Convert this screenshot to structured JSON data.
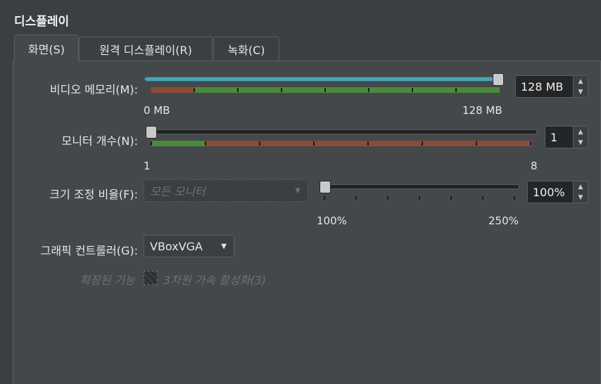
{
  "section_title": "디스플레이",
  "tabs": [
    {
      "label": "화면(S)",
      "active": true
    },
    {
      "label": "원격 디스플레이(R)",
      "active": false
    },
    {
      "label": "녹화(C)",
      "active": false
    }
  ],
  "video_memory": {
    "label": "비디오 메모리(M):",
    "value": "128 MB",
    "min_label": "0 MB",
    "max_label": "128 MB",
    "level_fraction": 1.0
  },
  "monitor_count": {
    "label": "모니터 개수(N):",
    "value": "1",
    "min_label": "1",
    "max_label": "8",
    "level_fraction": 0.0
  },
  "scale_factor": {
    "label": "크기 조정 비율(F):",
    "monitor_select": "모든 모니터",
    "value": "100%",
    "min_label": "100%",
    "max_label": "250%",
    "level_fraction": 0.0
  },
  "graphics_controller": {
    "label": "그래픽 컨트롤러(G):",
    "value": "VBoxVGA"
  },
  "extended_features": {
    "label": "확장된 기능",
    "checkbox_label": "3차원 가속 활성화(3)"
  },
  "colors": {
    "accent": "#3fa9b8",
    "good": "#4a8a3c",
    "warn": "#8b4c37",
    "bad": "#b03030"
  }
}
